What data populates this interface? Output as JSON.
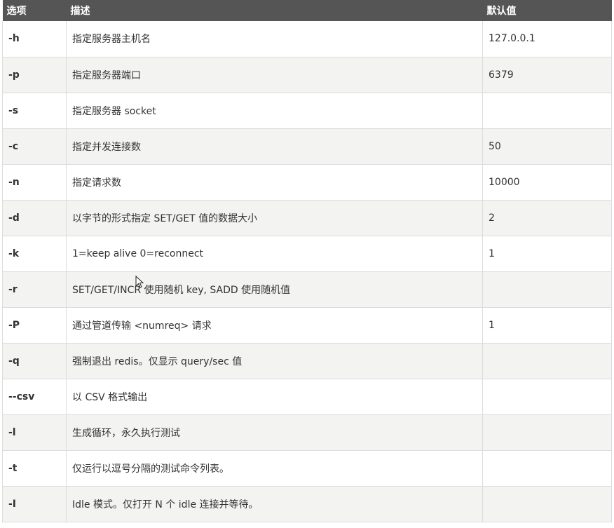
{
  "headers": {
    "option": "选项",
    "description": "描述",
    "default": "默认值"
  },
  "rows": [
    {
      "option": "-h",
      "description": "指定服务器主机名",
      "default": "127.0.0.1"
    },
    {
      "option": "-p",
      "description": "指定服务器端口",
      "default": "6379"
    },
    {
      "option": "-s",
      "description": "指定服务器 socket",
      "default": ""
    },
    {
      "option": "-c",
      "description": "指定并发连接数",
      "default": "50"
    },
    {
      "option": "-n",
      "description": "指定请求数",
      "default": "10000"
    },
    {
      "option": "-d",
      "description": "以字节的形式指定 SET/GET 值的数据大小",
      "default": "2"
    },
    {
      "option": "-k",
      "description": "1=keep alive 0=reconnect",
      "default": "1"
    },
    {
      "option": "-r",
      "description": "SET/GET/INCR 使用随机 key, SADD 使用随机值",
      "default": ""
    },
    {
      "option": "-P",
      "description": "通过管道传输 <numreq> 请求",
      "default": "1"
    },
    {
      "option": "-q",
      "description": "强制退出 redis。仅显示 query/sec 值",
      "default": ""
    },
    {
      "option": "--csv",
      "description": "以 CSV 格式输出",
      "default": ""
    },
    {
      "option": "-l",
      "description": "生成循环，永久执行测试",
      "default": ""
    },
    {
      "option": "-t",
      "description": "仅运行以逗号分隔的测试命令列表。",
      "default": ""
    },
    {
      "option": "-I",
      "description": "Idle 模式。仅打开 N 个 idle 连接并等待。",
      "default": ""
    }
  ]
}
